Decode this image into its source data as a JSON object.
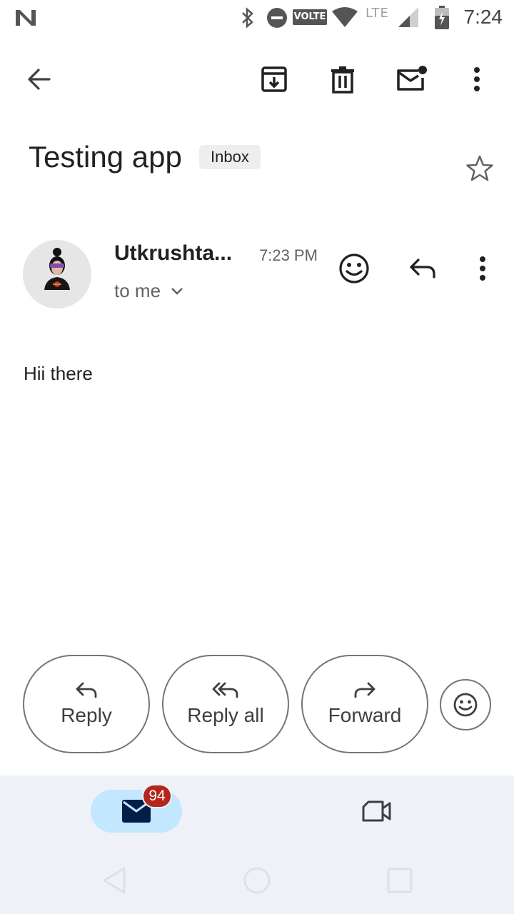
{
  "status_bar": {
    "time": "7:24",
    "volte": "VOLTE",
    "network": "LTE",
    "icons": [
      "n-notification-icon",
      "bluetooth-icon",
      "do-not-disturb-icon",
      "wifi-icon",
      "signal-icon",
      "battery-icon"
    ]
  },
  "toolbar": {
    "icons": [
      "back-arrow-icon",
      "archive-icon",
      "delete-icon",
      "mark-unread-icon",
      "more-vert-icon"
    ]
  },
  "email": {
    "subject": "Testing app",
    "label": "Inbox",
    "sender": "Utkrushta...",
    "time": "7:23 PM",
    "recipient": "to me",
    "body": "Hii there"
  },
  "actions": {
    "reply": "Reply",
    "reply_all": "Reply all",
    "forward": "Forward"
  },
  "bottom_nav": {
    "mail_badge": "94",
    "icons": [
      "mail-icon",
      "video-call-icon"
    ]
  },
  "system_nav": {
    "icons": [
      "back-triangle-icon",
      "home-circle-icon",
      "recents-square-icon"
    ]
  },
  "colors": {
    "accent": "#c2e7ff",
    "badge": "#b3261e",
    "nav_background": "#eef2f8",
    "text_primary": "#202124",
    "text_secondary": "#5f6368"
  }
}
